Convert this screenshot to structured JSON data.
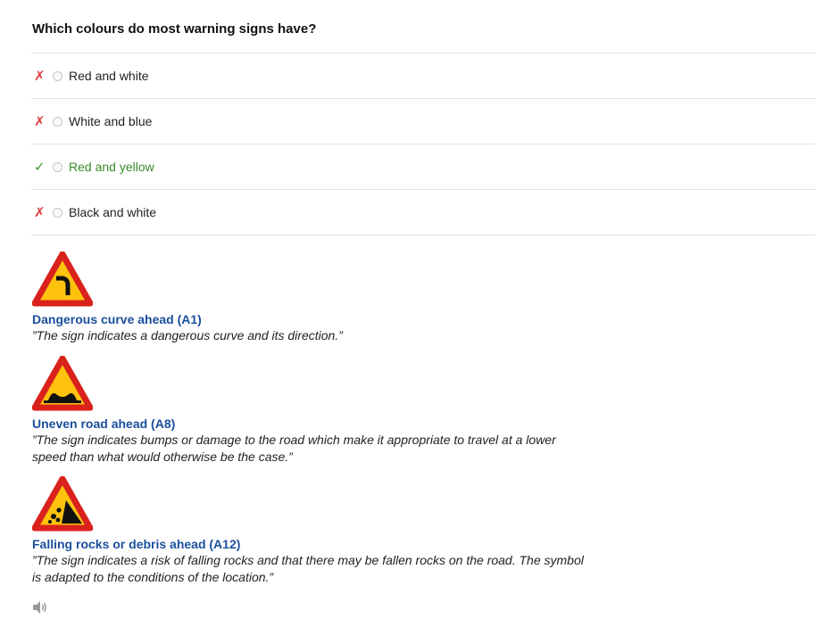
{
  "question": "Which colours do most warning signs have?",
  "options": [
    {
      "label": "Red and white",
      "mark": "✗",
      "status": "wrong"
    },
    {
      "label": "White and blue",
      "mark": "✗",
      "status": "wrong"
    },
    {
      "label": "Red and yellow",
      "mark": "✓",
      "status": "correct"
    },
    {
      "label": "Black and white",
      "mark": "✗",
      "status": "wrong"
    }
  ],
  "signs": [
    {
      "title": "Dangerous curve ahead (A1)",
      "description": "”The sign indicates a dangerous curve and its direction.”",
      "icon": "dangerous-curve-sign-icon"
    },
    {
      "title": "Uneven road ahead (A8)",
      "description": "”The sign indicates bumps or damage to the road which make it appropriate to travel at a lower speed than what would otherwise be the case.”",
      "icon": "uneven-road-sign-icon"
    },
    {
      "title": "Falling rocks or debris ahead (A12)",
      "description": "”The sign indicates a risk of falling rocks and that there may be fallen rocks on the road. The symbol is adapted to the conditions of the location.”",
      "icon": "falling-rocks-sign-icon"
    }
  ],
  "colors": {
    "wrong": "#e03c3c",
    "correct": "#3c9a2f",
    "link": "#1b4f9c",
    "sign_red": "#d9221c",
    "sign_yellow": "#ffc20e"
  }
}
